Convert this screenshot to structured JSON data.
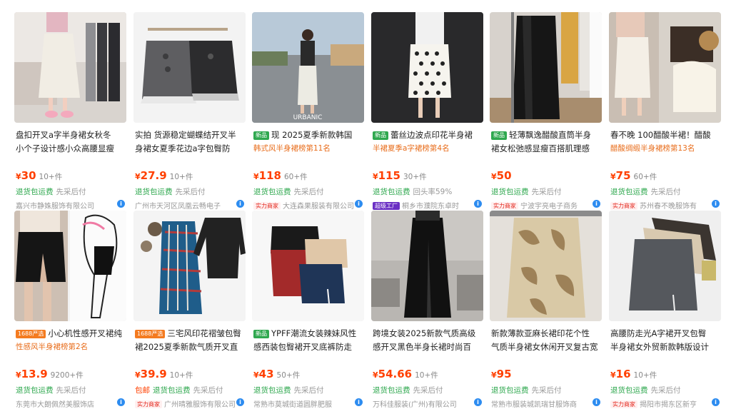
{
  "products": [
    {
      "title_lines": [
        "盘扣开叉a字半身裙女秋冬",
        "小个子设计感小众高腰显瘦"
      ],
      "price": "30",
      "sales": "10+件",
      "tags": [
        "退货包运费",
        "先采后付"
      ],
      "shop": "嘉兴市静姝服饰有限公司",
      "image": "skirt-photo-white-a-line"
    },
    {
      "title_lines": [
        "实拍 货源稳定蝴蝶结开叉半",
        "身裙女夏季花边a字包臀防"
      ],
      "price": "27.9",
      "sales": "10+件",
      "tags": [
        "退货包运费",
        "先采后付"
      ],
      "shop": "广州市天河区凤凰云畅电子",
      "image": "skirt-photo-gray-bow"
    },
    {
      "badge": "新品",
      "title_lines": [
        "现 2025夏季新款韩国",
        "韩式风半身裙榜第11名"
      ],
      "price": "118",
      "sales": "60+件",
      "tags": [
        "退货包运费",
        "先采后付"
      ],
      "strength_label": "实力商家",
      "shop": "大连森果服装有限公司",
      "image": "skirt-photo-white-street",
      "image_text": "URBANIC"
    },
    {
      "badge": "新品",
      "title_lines": [
        "蕾丝边波点印花半身裙",
        "半裙夏季a字裙榜第4名"
      ],
      "price": "115",
      "sales": "30+件",
      "tags": [
        "退货包运费",
        "回头率59%"
      ],
      "super_label": "超级工厂",
      "shop": "桐乡市濮院东卓时",
      "image": "skirt-photo-polka-dot"
    },
    {
      "badge": "新品",
      "title_lines": [
        "轻薄飘逸醋酸直筒半身",
        "裙女松弛感显瘦百搭肌理感"
      ],
      "price": "50",
      "sales": "",
      "tags": [
        "退货包运费",
        "先采后付"
      ],
      "strength_label": "实力商家",
      "shop": "宁波宇亮电子商务",
      "image": "skirt-photo-black-satin"
    },
    {
      "title_lines": [
        "春不晚 100醋酸半裙！醋酸",
        "醋酸绸缎半身裙榜第13名"
      ],
      "price": "75",
      "sales": "60+件",
      "tags": [
        "退货包运费",
        "先采后付"
      ],
      "strength_label": "实力商家",
      "shop": "苏州春不晚服饰有",
      "image": "skirt-photo-cream-long"
    },
    {
      "badge": "1688严选",
      "title_lines": [
        "小心机性感开叉裙纯",
        "性感风半身裙榜第2名"
      ],
      "price": "13.9",
      "sales": "9200+件",
      "tags": [
        "退货包运费",
        "先采后付"
      ],
      "shop": "东莞市大朗佩然美服饰店",
      "image": "skirt-photo-black-slit"
    },
    {
      "badge": "1688严选",
      "title_lines": [
        "三宅风印花褶皱包臀",
        "裙2025夏季新款气质开叉直"
      ],
      "price": "39.9",
      "sales": "10+件",
      "tags": [
        "包邮",
        "退货包运费",
        "先采后付"
      ],
      "strength_label": "实力商家",
      "shop": "广州晴雅服饰有限公司",
      "image": "skirt-photo-pleated-print"
    },
    {
      "badge": "新品",
      "title_lines": [
        "YPFF潮流女装辣妹风性",
        "感西装包臀裙开叉底裤防走"
      ],
      "price": "43",
      "sales": "50+件",
      "tags": [
        "退货包运费",
        "先采后付"
      ],
      "shop": "常熟市莫城街道圆胖肥服",
      "image": "skirt-photo-three-minis"
    },
    {
      "title_lines": [
        "跨境女装2025新款气质高级",
        "感开叉黑色半身长裙时尚百"
      ],
      "price": "54.66",
      "sales": "10+件",
      "tags": [
        "退货包运费",
        "先采后付"
      ],
      "shop": "万科佳服装(广州)有限公司",
      "image": "skirt-photo-black-maxi"
    },
    {
      "title_lines": [
        "新款薄款亚麻长裙印花个性",
        "气质半身裙女休闲开叉复古宽"
      ],
      "price": "95",
      "sales": "",
      "tags": [
        "退货包运费",
        "先采后付"
      ],
      "shop": "常熟市服装城凯瑞甘服饰商",
      "image": "skirt-photo-linen-print"
    },
    {
      "title_lines": [
        "高腰防走光A字裙开叉包臀",
        "半身裙女外贸新款韩版设计"
      ],
      "price": "16",
      "sales": "10+件",
      "tags": [
        "退货包运费",
        "先采后付"
      ],
      "strength_label": "实力商家",
      "shop": "揭阳市揭东区新亨",
      "image": "skirt-photo-gray-mini"
    }
  ],
  "currency_symbol": "¥",
  "info_icon_glyph": "i",
  "colors": {
    "price": "#ff4000",
    "green_tag": "#2fa84f",
    "rank": "#e86c1a",
    "info": "#2d8cf0"
  }
}
